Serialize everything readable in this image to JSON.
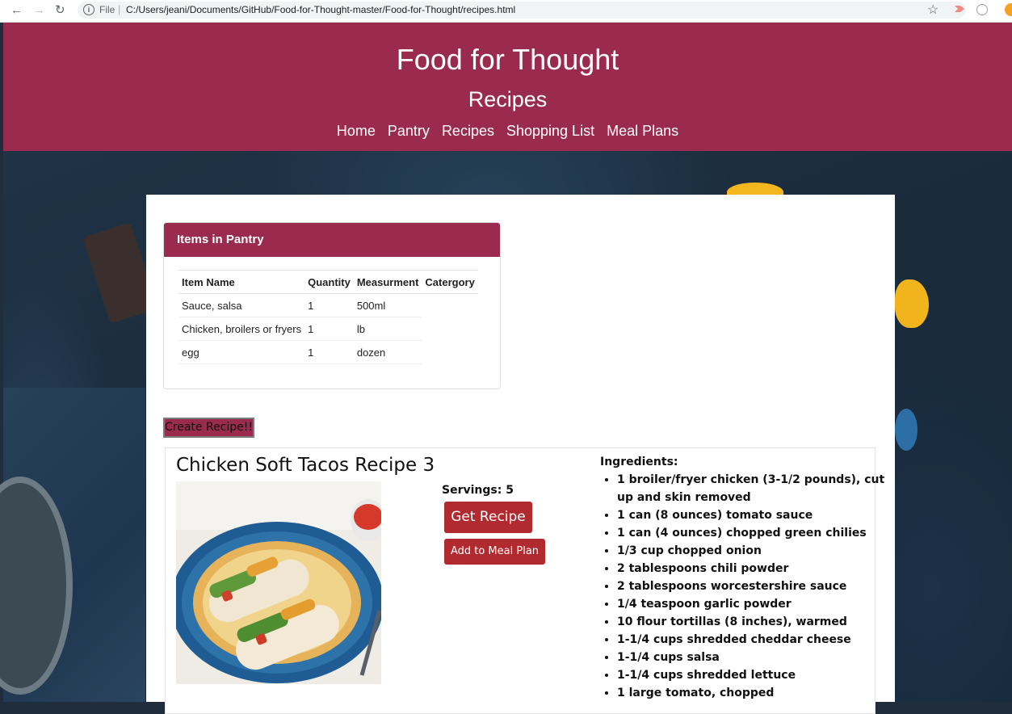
{
  "browser": {
    "file_label": "File",
    "url": "C:/Users/jeani/Documents/GitHub/Food-for-Thought-master/Food-for-Thought/recipes.html"
  },
  "header": {
    "title": "Food for Thought",
    "subtitle": "Recipes",
    "nav": [
      "Home",
      "Pantry",
      "Recipes",
      "Shopping List",
      "Meal Plans"
    ]
  },
  "pantry": {
    "heading": "Items in Pantry",
    "columns": [
      "Item Name",
      "Quantity",
      "Measurment",
      "Catergory"
    ],
    "rows": [
      {
        "name": "Sauce, salsa",
        "quantity": "1",
        "measurement": "500ml",
        "category": ""
      },
      {
        "name": "Chicken, broilers or fryers",
        "quantity": "1",
        "measurement": "lb",
        "category": ""
      },
      {
        "name": "egg",
        "quantity": "1",
        "measurement": "dozen",
        "category": ""
      }
    ]
  },
  "create_button": "Create Recipe!!",
  "recipe": {
    "title": "Chicken Soft Tacos Recipe 3",
    "servings": "Servings: 5",
    "get_recipe": "Get Recipe",
    "add_meal_plan": "Add to Meal Plan",
    "ingredients_label": "Ingredients:",
    "ingredients": [
      "1 broiler/fryer chicken (3-1/2 pounds), cut up and skin removed",
      "1 can (8 ounces) tomato sauce",
      "1 can (4 ounces) chopped green chilies",
      "1/3 cup chopped onion",
      "2 tablespoons chili powder",
      "2 tablespoons worcestershire sauce",
      "1/4 teaspoon garlic powder",
      "10 flour tortillas (8 inches), warmed",
      "1-1/4 cups shredded cheddar cheese",
      "1-1/4 cups salsa",
      "1-1/4 cups shredded lettuce",
      "1 large tomato, chopped"
    ]
  },
  "colors": {
    "brand": "#9a2b4e",
    "button": "#b12a2f"
  }
}
